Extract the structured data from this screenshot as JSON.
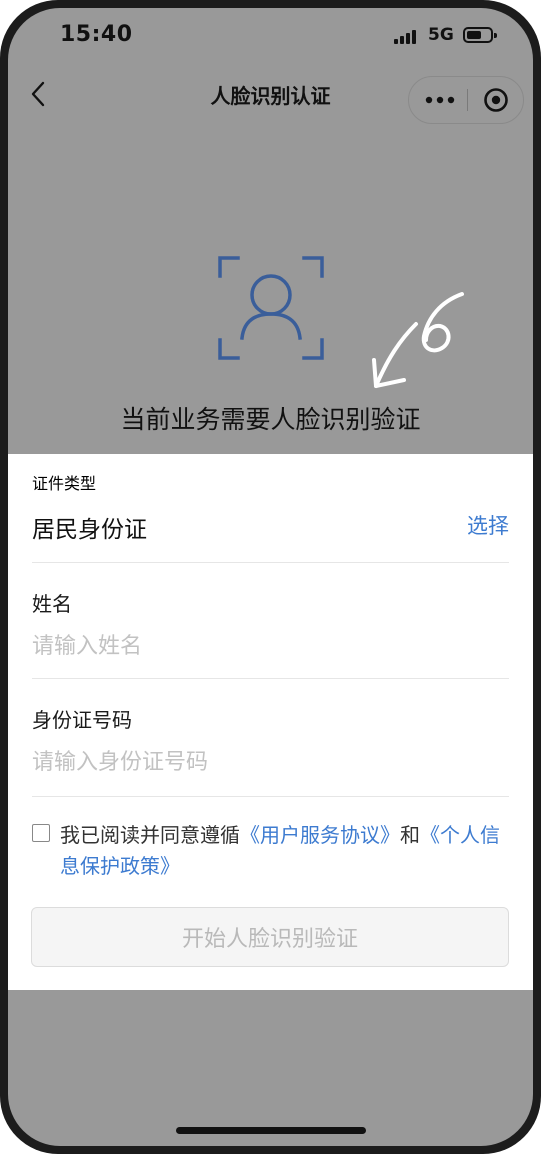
{
  "status_bar": {
    "time": "15:40",
    "network": "5G"
  },
  "nav": {
    "title": "人脸识别认证"
  },
  "hero": {
    "hint": "当前业务需要人脸识别验证",
    "annotation": "6"
  },
  "form": {
    "id_type": {
      "label": "证件类型",
      "value": "居民身份证",
      "select_label": "选择"
    },
    "name": {
      "label": "姓名",
      "placeholder": "请输入姓名"
    },
    "id_number": {
      "label": "身份证号码",
      "placeholder": "请输入身份证号码"
    }
  },
  "agreement": {
    "prefix": "我已阅读并同意遵循",
    "user_agreement": "《用户服务协议》",
    "and": "和",
    "privacy_policy": "《个人信息保护政策》"
  },
  "start_button": {
    "label": "开始人脸识别验证"
  },
  "colors": {
    "accent": "#3d7bd0",
    "icon_blue": "#3a5e9a",
    "overlay_gray": "#999999"
  }
}
